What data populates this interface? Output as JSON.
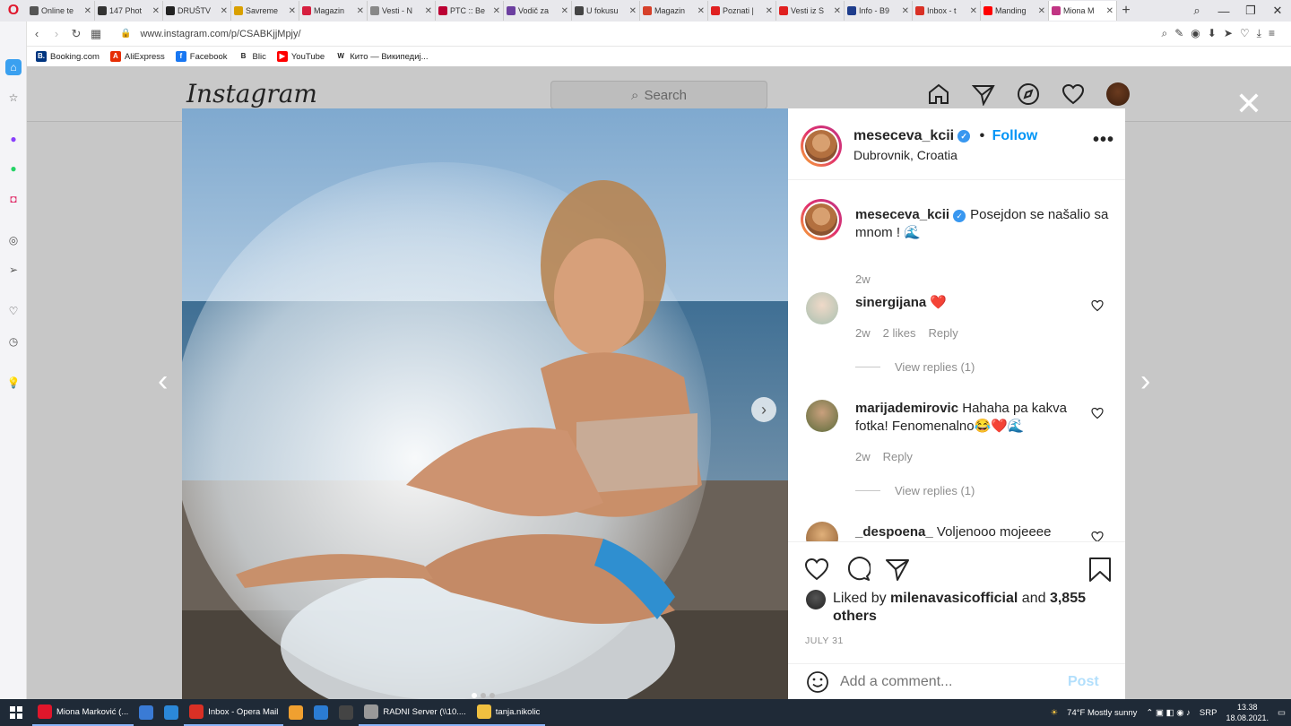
{
  "browser": {
    "tabs": [
      {
        "label": "Online te",
        "color": "#555"
      },
      {
        "label": "147 Phot",
        "color": "#333"
      },
      {
        "label": "DRUŠTV",
        "color": "#222"
      },
      {
        "label": "Savreme",
        "color": "#d9a000"
      },
      {
        "label": "Magazin",
        "color": "#d61f3f"
      },
      {
        "label": "Vesti - N",
        "color": "#888"
      },
      {
        "label": "PTC :: Be",
        "color": "#b03"
      },
      {
        "label": "Vodič za",
        "color": "#6c3fa0"
      },
      {
        "label": "U fokusu",
        "color": "#444"
      },
      {
        "label": "Magazin",
        "color": "#d6402a"
      },
      {
        "label": "Poznati |",
        "color": "#e02020"
      },
      {
        "label": "Vesti iz S",
        "color": "#e02020"
      },
      {
        "label": "Info - B9",
        "color": "#1e3c8c"
      },
      {
        "label": "Inbox - t",
        "color": "#d93025"
      },
      {
        "label": "Manding",
        "color": "#ff0000"
      },
      {
        "label": "Miona M",
        "color": "#c13584",
        "active": true
      }
    ],
    "url": "www.instagram.com/p/CSABKjjMpjy/",
    "bookmarks": [
      {
        "label": "Booking.com",
        "icon": "B.",
        "color": "#003580"
      },
      {
        "label": "AliExpress",
        "icon": "A",
        "color": "#e62e04"
      },
      {
        "label": "Facebook",
        "icon": "f",
        "color": "#1877f2"
      },
      {
        "label": "Blic",
        "icon": "B",
        "color": "#ffffff"
      },
      {
        "label": "YouTube",
        "icon": "▶",
        "color": "#ff0000"
      },
      {
        "label": "Кито — Википедиј...",
        "icon": "W",
        "color": "#ffffff"
      }
    ]
  },
  "instagram": {
    "logo": "Instagram",
    "search_placeholder": "Search",
    "post": {
      "username": "meseceva_kcii",
      "follow_label": "Follow",
      "location": "Dubrovnik, Croatia",
      "caption": {
        "username": "meseceva_kcii",
        "text": "Posejdon se našalio sa mnom ! 🌊",
        "time": "2w"
      },
      "comments": [
        {
          "username": "sinergijana",
          "text": "❤️",
          "time": "2w",
          "likes": "2 likes",
          "reply": "Reply",
          "view_replies": "View replies (1)"
        },
        {
          "username": "marijademirovic",
          "text": "Hahaha pa kakva fotka! Fenomenalno😂❤️🌊",
          "time": "2w",
          "likes": "",
          "reply": "Reply",
          "view_replies": "View replies (1)"
        },
        {
          "username": "_despoena_",
          "text": "Voljenooo mojeeee"
        }
      ],
      "liked_by_prefix": "Liked by",
      "liked_by_user": "milenavasicofficial",
      "liked_by_and": "and",
      "liked_others": "3,855 others",
      "date": "JULY 31",
      "comment_placeholder": "Add a comment...",
      "post_label": "Post"
    }
  },
  "taskbar": {
    "items": [
      {
        "label": "Miona Marković (...",
        "color": "#e0162b"
      },
      {
        "label": "",
        "color": "#3a7bd5"
      },
      {
        "label": "",
        "color": "#2b88d8"
      },
      {
        "label": "Inbox - Opera Mail",
        "color": "#d93025"
      },
      {
        "label": "",
        "color": "#f0a030"
      },
      {
        "label": "",
        "color": "#2b7cd3"
      },
      {
        "label": "",
        "color": "#444"
      },
      {
        "label": "RADNI Server (\\\\10....",
        "color": "#999"
      },
      {
        "label": "tanja.nikolic",
        "color": "#f0c040"
      }
    ],
    "weather": "74°F  Mostly sunny",
    "lang": "SRP",
    "time": "13.38",
    "date": "18.08.2021."
  }
}
